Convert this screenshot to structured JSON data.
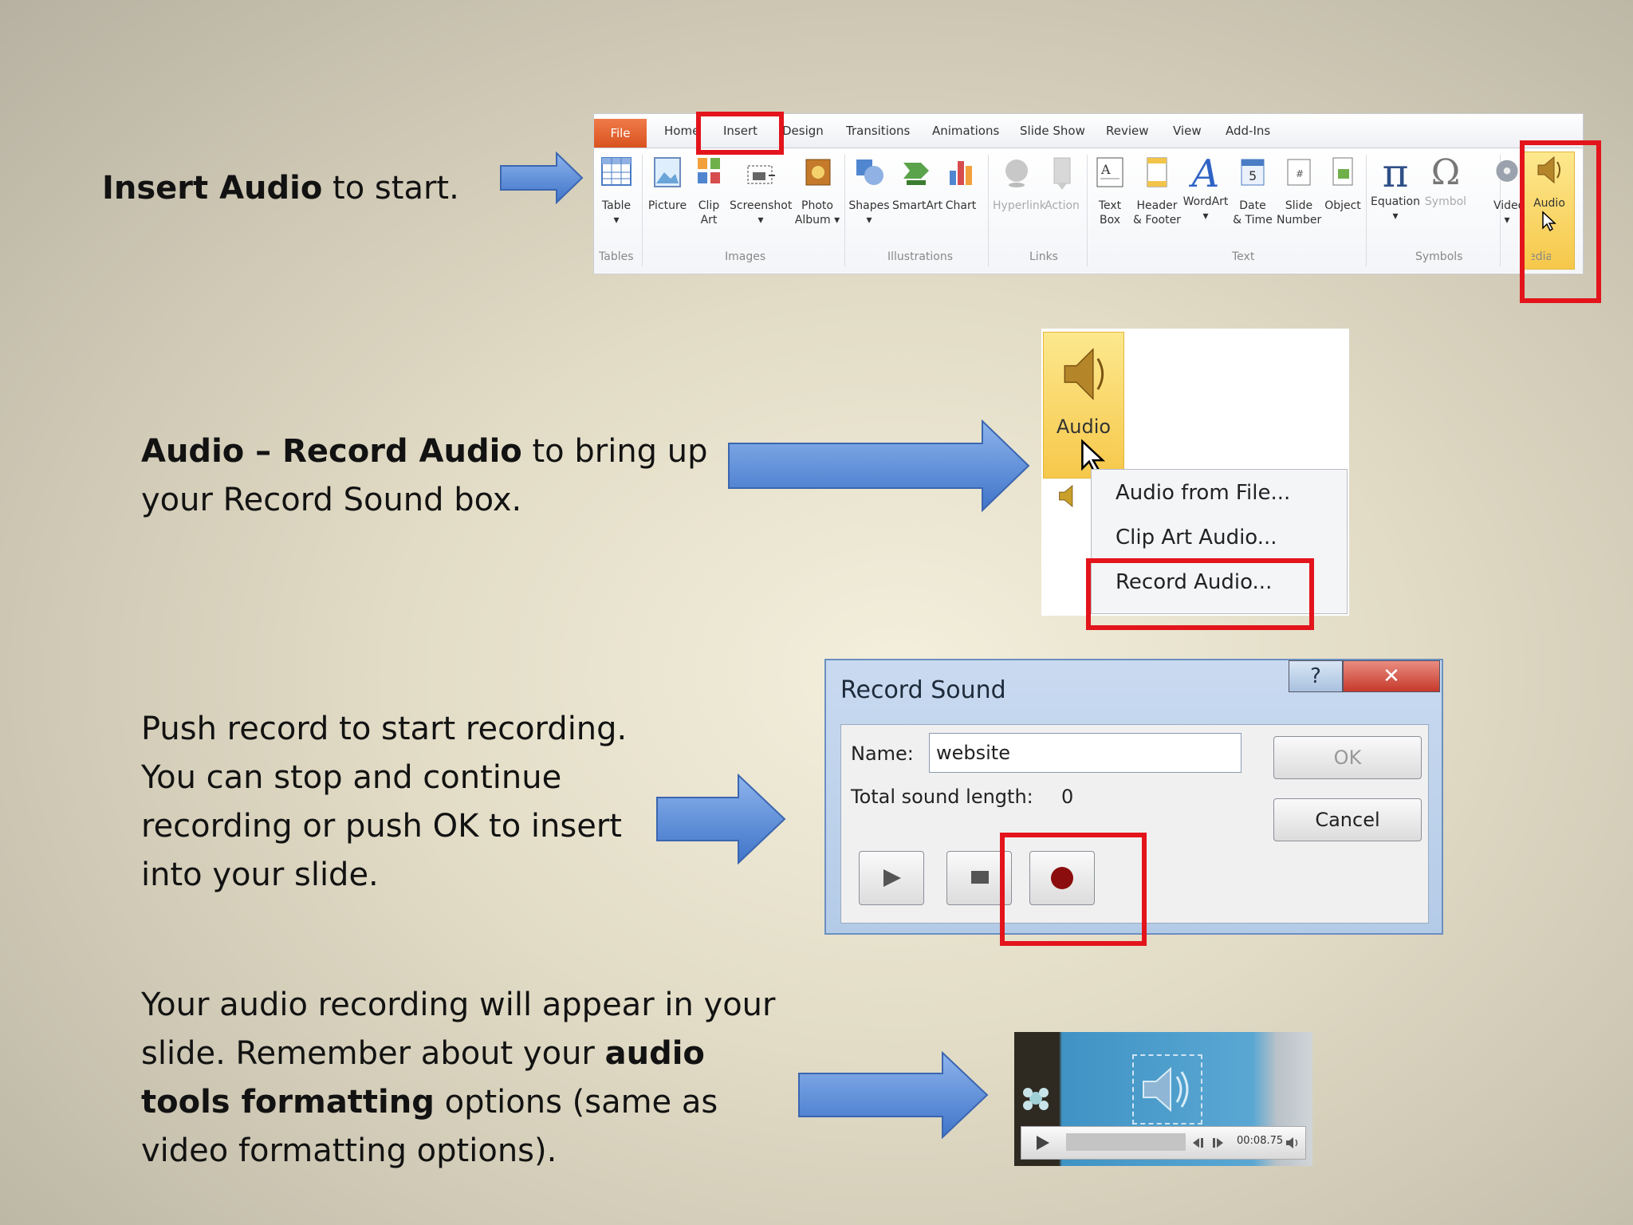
{
  "steps": [
    {
      "bold": "Insert Audio",
      "rest": " to start."
    },
    {
      "bold": "Audio – Record Audio",
      "rest": " to bring up your Record Sound box."
    },
    {
      "text": "Push record to start recording.  You can stop and continue recording or push OK to insert into your slide."
    },
    {
      "pre": "Your audio recording will appear in your slide.  Remember about your ",
      "bold": "audio tools formatting",
      "rest": " options (same as video formatting options)."
    }
  ],
  "ribbon": {
    "file_tab": "File",
    "tabs": [
      "Home",
      "Insert",
      "Design",
      "Transitions",
      "Animations",
      "Slide Show",
      "Review",
      "View",
      "Add-Ins"
    ],
    "buttons": [
      {
        "label": "Table",
        "sub": "▾",
        "icon": "table-icon"
      },
      {
        "label": "Picture",
        "sub": "",
        "icon": "picture-icon"
      },
      {
        "label": "Clip",
        "sub": "Art",
        "icon": "clip-art-icon"
      },
      {
        "label": "Screenshot",
        "sub": "▾",
        "icon": "screenshot-icon"
      },
      {
        "label": "Photo",
        "sub": "Album ▾",
        "icon": "photo-album-icon"
      },
      {
        "label": "Shapes",
        "sub": "▾",
        "icon": "shapes-icon"
      },
      {
        "label": "SmartArt",
        "sub": "",
        "icon": "smartart-icon"
      },
      {
        "label": "Chart",
        "sub": "",
        "icon": "chart-icon"
      },
      {
        "label": "Hyperlink",
        "sub": "",
        "icon": "hyperlink-icon"
      },
      {
        "label": "Action",
        "sub": "",
        "icon": "action-icon"
      },
      {
        "label": "Text",
        "sub": "Box",
        "icon": "text-box-icon"
      },
      {
        "label": "Header",
        "sub": "& Footer",
        "icon": "header-footer-icon"
      },
      {
        "label": "WordArt",
        "sub": "▾",
        "icon": "wordart-icon"
      },
      {
        "label": "Date",
        "sub": "& Time",
        "icon": "date-time-icon"
      },
      {
        "label": "Slide",
        "sub": "Number",
        "icon": "slide-number-icon"
      },
      {
        "label": "Object",
        "sub": "",
        "icon": "object-icon"
      },
      {
        "label": "Equation",
        "sub": "▾",
        "icon": "equation-icon"
      },
      {
        "label": "Symbol",
        "sub": "",
        "icon": "symbol-icon"
      },
      {
        "label": "Video",
        "sub": "▾",
        "icon": "video-icon"
      },
      {
        "label": "Audio",
        "sub": "",
        "icon": "audio-icon"
      }
    ],
    "groups": [
      "Tables",
      "Images",
      "Illustrations",
      "Links",
      "Text",
      "Symbols",
      "Media"
    ],
    "symbols": {
      "pi": "π",
      "omega": "Ω",
      "wordart": "A"
    }
  },
  "audio_menu": {
    "button_label": "Audio",
    "items": [
      "Audio from File...",
      "Clip Art Audio...",
      "Record Audio..."
    ]
  },
  "dialog": {
    "title": "Record Sound",
    "help": "?",
    "close": "✕",
    "name_label": "Name:",
    "name_value": "website",
    "length_label": "Total sound length:",
    "length_value": "0",
    "ok": "OK",
    "cancel": "Cancel"
  },
  "player": {
    "time": "00:08.75"
  },
  "colors": {
    "highlight": "#e3141b",
    "arrow": "#5b8fd9",
    "accent": "#f6c84a"
  }
}
